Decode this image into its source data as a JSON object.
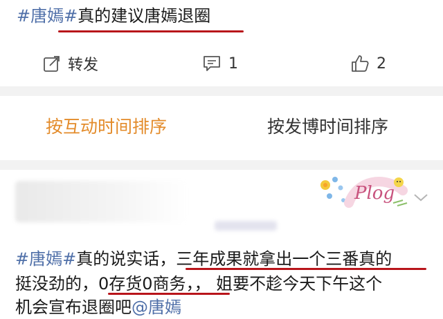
{
  "post": {
    "topic": "#唐嫣#",
    "title": "真的建议唐嫣退圈"
  },
  "actions": {
    "repost_label": "转发",
    "comment_count": "1",
    "like_count": "2"
  },
  "sort_tabs": {
    "by_interaction": "按互动时间排序",
    "by_post_time": "按发博时间排序"
  },
  "comment": {
    "sticker_text": "Plog",
    "line1_topic": "#唐嫣#",
    "line1_a": "真的说实话，",
    "line1_b": "三年成果就拿出一个三番真的",
    "line2_a": "挺没劲的，",
    "line2_b": "0存货0商务，，",
    "line2_c": " 姐要不趁今天下午这个",
    "line3_a": "机会宣布退圈吧",
    "line3_mention": "@唐嫣"
  },
  "colors": {
    "topic_blue": "#4f6fa8",
    "underline_red": "#b8141a",
    "active_tab_orange": "#e38b2a",
    "separator_gray": "#f2f2f2"
  }
}
